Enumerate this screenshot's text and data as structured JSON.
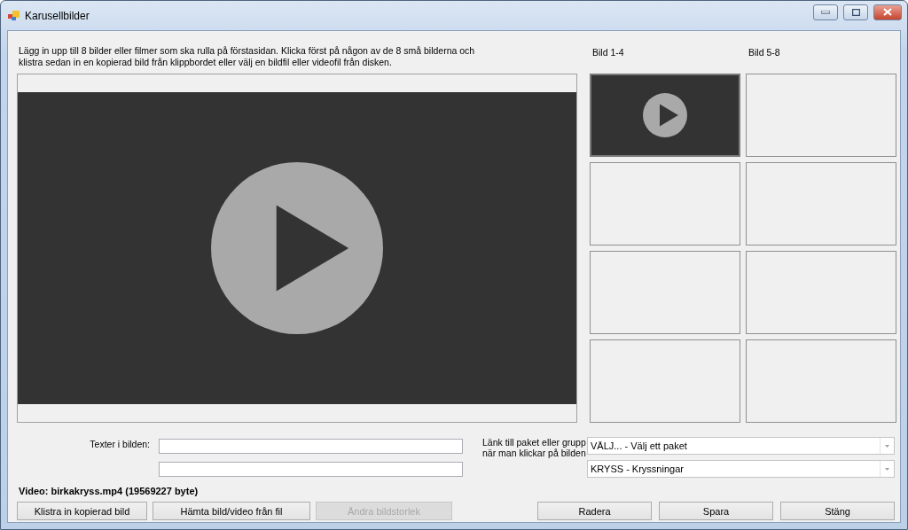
{
  "window": {
    "title": "Karusellbilder"
  },
  "description": "Lägg in upp till 8 bilder eller filmer som ska rulla på förstasidan. Klicka först på någon av de 8 små bilderna och klistra sedan in en kopierad bild från klippbordet eller välj en bildfil eller videofil från disken.",
  "preview": {
    "kind": "video"
  },
  "thumbnail_headers": [
    "Bild 1-4",
    "Bild 5-8"
  ],
  "thumbnails": [
    {
      "kind": "video",
      "selected": true
    },
    {
      "kind": "empty",
      "selected": false
    },
    {
      "kind": "empty",
      "selected": false
    },
    {
      "kind": "empty",
      "selected": false
    },
    {
      "kind": "empty",
      "selected": false
    },
    {
      "kind": "empty",
      "selected": false
    },
    {
      "kind": "empty",
      "selected": false
    },
    {
      "kind": "empty",
      "selected": false
    }
  ],
  "text_fields_label": "Texter i bilden:",
  "link_label": "Länk till paket eller grupp när man klickar på bilden",
  "link_selects": [
    {
      "value": "VÄLJ... - Välj ett paket"
    },
    {
      "value": "KRYSS - Kryssningar"
    }
  ],
  "video_info": "Video: birkakryss.mp4 (19569227 byte)",
  "left_buttons": [
    {
      "label": "Klistra in kopierad bild",
      "disabled": false
    },
    {
      "label": "Hämta bild/video från fil",
      "disabled": false
    },
    {
      "label": "Ändra bildstorlek",
      "disabled": true
    }
  ],
  "right_buttons": [
    {
      "label": "Radera",
      "disabled": false
    },
    {
      "label": "Spara",
      "disabled": false
    },
    {
      "label": "Stäng",
      "disabled": false
    }
  ]
}
